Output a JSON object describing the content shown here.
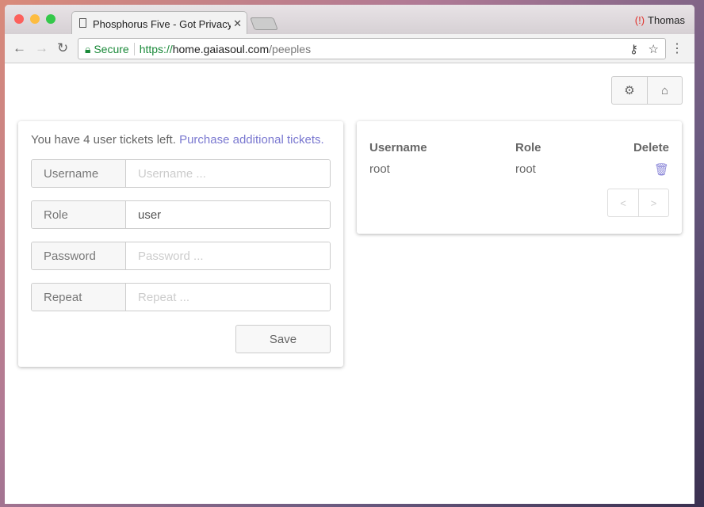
{
  "browser": {
    "tab_title": "Phosphorus Five - Got Privacy?",
    "profile": "Thomas",
    "secure_label": "Secure",
    "url_scheme": "https://",
    "url_host": "home.gaiasoul.com",
    "url_path": "/peeples"
  },
  "toolbar": {
    "settings_icon": "gear-icon",
    "home_icon": "home-icon"
  },
  "form": {
    "intro": "You have 4 user tickets left.",
    "purchase_link": "Purchase additional tickets.",
    "fields": [
      {
        "label": "Username",
        "value": "",
        "placeholder": "Username ..."
      },
      {
        "label": "Role",
        "value": "user",
        "placeholder": ""
      },
      {
        "label": "Password",
        "value": "",
        "placeholder": "Password ..."
      },
      {
        "label": "Repeat",
        "value": "",
        "placeholder": "Repeat ..."
      }
    ],
    "save_label": "Save"
  },
  "users": {
    "headers": [
      "Username",
      "Role",
      "Delete"
    ],
    "rows": [
      {
        "username": "root",
        "role": "root"
      }
    ],
    "prev": "<",
    "next": ">"
  },
  "colors": {
    "accent": "#7a78d0",
    "secure": "#1b8a3a"
  }
}
